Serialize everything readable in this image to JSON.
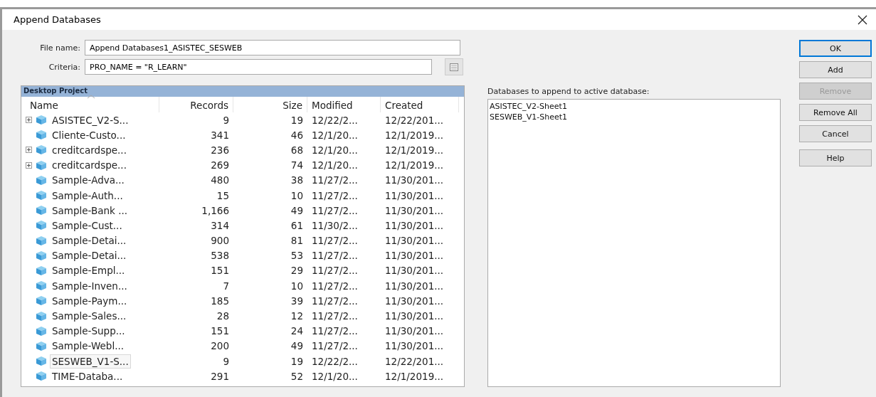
{
  "window": {
    "title": "Append Databases"
  },
  "file_name": {
    "label": "File name:",
    "value": "Append Databases1_ASISTEC_SESWEB"
  },
  "criteria": {
    "label": "Criteria:",
    "value": "PRO_NAME = \"R_LEARN\""
  },
  "tree": {
    "title": "Desktop Project",
    "columns": [
      "Name",
      "Records",
      "Size",
      "Modified",
      "Created"
    ],
    "rows": [
      {
        "name": "ASISTEC_V2-S...",
        "records": "9",
        "size": "19",
        "modified": "12/22/2...",
        "created": "12/22/201...",
        "expandable": true,
        "selected": false
      },
      {
        "name": "Cliente-Custo...",
        "records": "341",
        "size": "46",
        "modified": "12/1/20...",
        "created": "12/1/2019...",
        "expandable": false,
        "selected": false
      },
      {
        "name": "creditcardspe...",
        "records": "236",
        "size": "68",
        "modified": "12/1/20...",
        "created": "12/1/2019...",
        "expandable": true,
        "selected": false
      },
      {
        "name": "creditcardspe...",
        "records": "269",
        "size": "74",
        "modified": "12/1/20...",
        "created": "12/1/2019...",
        "expandable": true,
        "selected": false
      },
      {
        "name": "Sample-Adva...",
        "records": "480",
        "size": "38",
        "modified": "11/27/2...",
        "created": "11/30/201...",
        "expandable": false,
        "selected": false
      },
      {
        "name": "Sample-Auth...",
        "records": "15",
        "size": "10",
        "modified": "11/27/2...",
        "created": "11/30/201...",
        "expandable": false,
        "selected": false
      },
      {
        "name": "Sample-Bank ...",
        "records": "1,166",
        "size": "49",
        "modified": "11/27/2...",
        "created": "11/30/201...",
        "expandable": false,
        "selected": false
      },
      {
        "name": "Sample-Cust...",
        "records": "314",
        "size": "61",
        "modified": "11/30/2...",
        "created": "11/30/201...",
        "expandable": false,
        "selected": false
      },
      {
        "name": "Sample-Detai...",
        "records": "900",
        "size": "81",
        "modified": "11/27/2...",
        "created": "11/30/201...",
        "expandable": false,
        "selected": false
      },
      {
        "name": "Sample-Detai...",
        "records": "538",
        "size": "53",
        "modified": "11/27/2...",
        "created": "11/30/201...",
        "expandable": false,
        "selected": false
      },
      {
        "name": "Sample-Empl...",
        "records": "151",
        "size": "29",
        "modified": "11/27/2...",
        "created": "11/30/201...",
        "expandable": false,
        "selected": false
      },
      {
        "name": "Sample-Inven...",
        "records": "7",
        "size": "10",
        "modified": "11/27/2...",
        "created": "11/30/201...",
        "expandable": false,
        "selected": false
      },
      {
        "name": "Sample-Paym...",
        "records": "185",
        "size": "39",
        "modified": "11/27/2...",
        "created": "11/30/201...",
        "expandable": false,
        "selected": false
      },
      {
        "name": "Sample-Sales...",
        "records": "28",
        "size": "12",
        "modified": "11/27/2...",
        "created": "11/30/201...",
        "expandable": false,
        "selected": false
      },
      {
        "name": "Sample-Supp...",
        "records": "151",
        "size": "24",
        "modified": "11/27/2...",
        "created": "11/30/201...",
        "expandable": false,
        "selected": false
      },
      {
        "name": "Sample-Webl...",
        "records": "200",
        "size": "49",
        "modified": "11/27/2...",
        "created": "11/30/201...",
        "expandable": false,
        "selected": false
      },
      {
        "name": "SESWEB_V1-S...",
        "records": "9",
        "size": "19",
        "modified": "12/22/2...",
        "created": "12/22/201...",
        "expandable": false,
        "selected": true
      },
      {
        "name": "TIME-Databa...",
        "records": "291",
        "size": "52",
        "modified": "12/1/20...",
        "created": "12/1/2019...",
        "expandable": false,
        "selected": false
      }
    ]
  },
  "append_list": {
    "label": "Databases to append to active database:",
    "items": [
      "ASISTEC_V2-Sheet1",
      "SESWEB_V1-Sheet1"
    ]
  },
  "buttons": [
    {
      "label": "OK",
      "default": true,
      "disabled": false
    },
    {
      "label": "Add",
      "default": false,
      "disabled": false
    },
    {
      "label": "Remove",
      "default": false,
      "disabled": true
    },
    {
      "label": "Remove All",
      "default": false,
      "disabled": false
    },
    {
      "label": "Cancel",
      "default": false,
      "disabled": false
    },
    {
      "label": "Help",
      "default": false,
      "disabled": false
    }
  ]
}
